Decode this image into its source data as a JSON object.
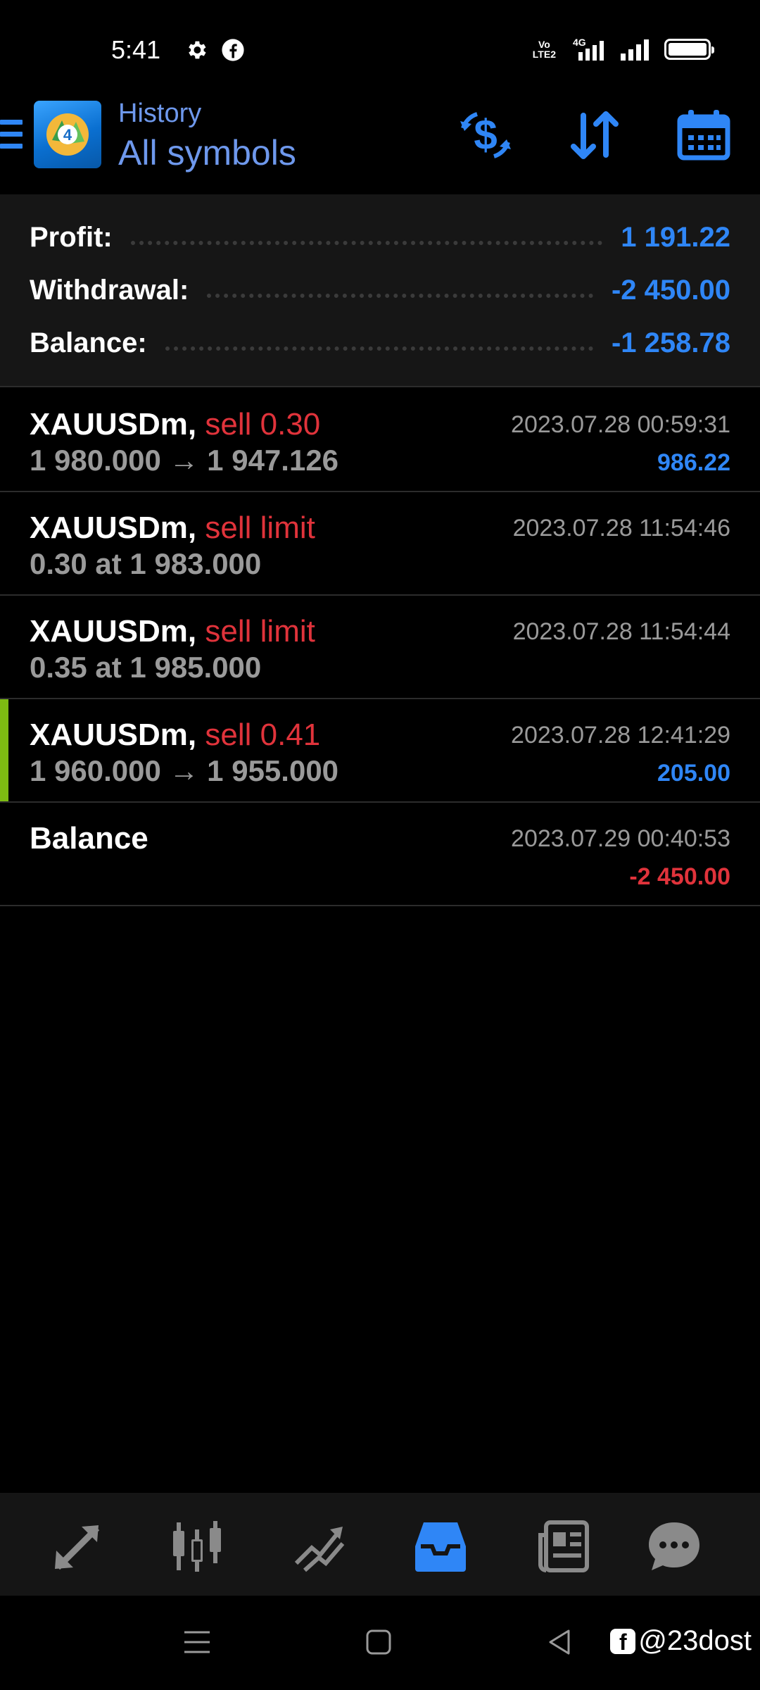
{
  "status_bar": {
    "time": "5:41",
    "network_top": "Vo",
    "network_bottom": "LTE2",
    "network_type": "4G",
    "icons": [
      "settings-gear-icon",
      "facebook-icon",
      "volte-icon",
      "signal-4g-icon",
      "signal-icon",
      "battery-icon"
    ]
  },
  "header": {
    "title": "History",
    "subtitle": "All symbols",
    "logo": "metatrader-logo",
    "logo_number": "4",
    "buttons": [
      "exchange-dollar-icon",
      "sort-arrows-icon",
      "calendar-icon"
    ],
    "accent_color": "#2f86f6"
  },
  "summary": {
    "profit_label": "Profit:",
    "profit_value": "1 191.22",
    "withdrawal_label": "Withdrawal:",
    "withdrawal_value": "-2 450.00",
    "balance_label": "Balance:",
    "balance_value": "-1 258.78"
  },
  "history": [
    {
      "symbol": "XAUUSDm,",
      "type": "sell 0.30",
      "detail": "1 980.000 → 1 947.126",
      "time": "2023.07.28 00:59:31",
      "profit": "986.22",
      "profit_color": "#2f86f6"
    },
    {
      "symbol": "XAUUSDm,",
      "type": "sell limit",
      "detail": "0.30 at 1 983.000",
      "time": "2023.07.28 11:54:46",
      "profit": ""
    },
    {
      "symbol": "XAUUSDm,",
      "type": "sell limit",
      "detail": "0.35 at 1 985.000",
      "time": "2023.07.28 11:54:44",
      "profit": ""
    },
    {
      "symbol": "XAUUSDm,",
      "type": "sell 0.41",
      "detail": "1 960.000 → 1 955.000",
      "time": "2023.07.28 12:41:29",
      "profit": "205.00",
      "profit_color": "#2f86f6",
      "selected": true
    },
    {
      "symbol": "Balance",
      "type": "",
      "detail": "",
      "time": "2023.07.29 00:40:53",
      "profit": "-2 450.00",
      "profit_color": "#e0333b"
    }
  ],
  "tab_bar": {
    "tabs": [
      "quotes-tab-icon",
      "chart-tab-icon",
      "trade-tab-icon",
      "history-tab-icon",
      "news-tab-icon",
      "messages-tab-icon"
    ],
    "active_tab": "history-tab-icon",
    "active_color": "#2f86f6"
  },
  "system_nav": {
    "buttons": [
      "recent-apps-icon",
      "home-icon",
      "back-icon"
    ]
  },
  "watermark": {
    "badge": "f",
    "text": "@23dost"
  }
}
